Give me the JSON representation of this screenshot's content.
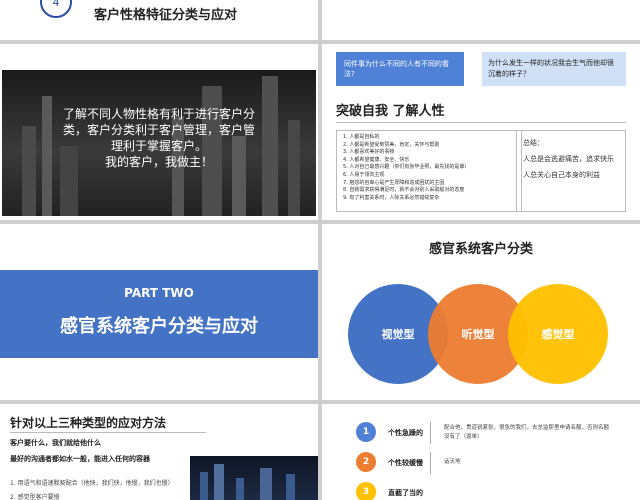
{
  "slide1": {
    "number": "4",
    "title": "客户性格特征分类与应对"
  },
  "slide3": {
    "lines": [
      "了解不同人物性格有利于进行客户分",
      "类，客户分类利于客户管理，客户管",
      "理利于掌握客户。",
      "我的客户，我做主！"
    ]
  },
  "slide4": {
    "question1": "同件事为什么不同的人有不同的看法?",
    "question2": "为什么发生一样的状况我会生气而他却很沉着的样子？",
    "title": "突破自我 了解人性",
    "list": [
      "1.  人都是自私的",
      "2.  人都是希望受到赞美，肯定，关怀与帮助",
      "3.  人都喜欢美好的事物",
      "4.  人都希望健康、安全、快乐",
      "5.  人对自己最感兴趣（你们有张毕业照，最先找的是谁）",
      "6.  人易于领向主观",
      "7.  抱怨的自卑心是产生厚障和造成困扰的主因",
      "8.  自我需求获得满足时，就不会对别人采取敌对的态度",
      "9.  有了利害关系时，人际关系必然错综复杂"
    ],
    "summary_label": "总结：",
    "summary1": "人总是会逃避痛苦，追求快乐",
    "summary2": "人总关心自己本身的利益"
  },
  "slide5": {
    "part": "PART TWO",
    "title": "感官系统客户分类与应对"
  },
  "slide6": {
    "title": "感官系统客户分类",
    "circles": [
      "视觉型",
      "听觉型",
      "感觉型"
    ],
    "colors": {
      "visual": "#4472c4",
      "auditory": "#ed7d31",
      "kinesthetic": "#ffc000"
    }
  },
  "slide7": {
    "title": "针对以上三种类型的应对方法",
    "line1": "客户要什么，我们就给他什么",
    "line2": "最好的沟通者都如水一般，能进入任何的容器",
    "line3": "1. 用语气和语速默契配合（他快，我们快，他慢，我们也慢）",
    "line4": "2. 感觉型客户要慢"
  },
  "slide8": {
    "items": [
      {
        "num": "1",
        "label": "个性急躁的",
        "desc": "配合他，贯道锐紧张，很急的我们，去总监那里申请名额，否则名额没有了（逼单）"
      },
      {
        "num": "2",
        "label": "个性较缓慢",
        "desc": "话天地"
      },
      {
        "num": "3",
        "label": "直截了当的",
        "desc": ""
      }
    ],
    "colors": [
      "#4f81d6",
      "#ed7d31",
      "#ffc000"
    ]
  }
}
